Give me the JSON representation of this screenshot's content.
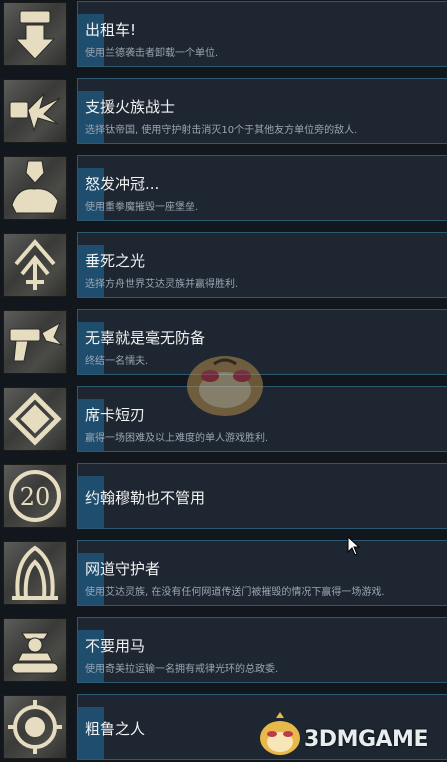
{
  "achievements": [
    {
      "title": "出租车!",
      "desc": "使用兰德袭击者卸载一个单位.",
      "icon": "taxi-arrow-icon"
    },
    {
      "title": "支援火族战士",
      "desc": "选择钛帝国, 使用守护射击消灭10个于其他友方单位旁的敌人.",
      "icon": "fire-support-icon"
    },
    {
      "title": "怒发冲冠...",
      "desc": "使用重拳魔摧毁一座堡垒.",
      "icon": "fist-icon"
    },
    {
      "title": "垂死之光",
      "desc": "选择方舟世界艾达灵族并赢得胜利.",
      "icon": "eldar-rune-icon"
    },
    {
      "title": "无辜就是毫无防备",
      "desc": "终结一名懦夫.",
      "icon": "pistol-icon"
    },
    {
      "title": "席卡短刃",
      "desc": "赢得一场困难及以上难度的单人游戏胜利.",
      "icon": "diamond-blade-icon"
    },
    {
      "title": "约翰穆勒也不管用",
      "desc": "",
      "icon": "number-20-icon",
      "badge": "20"
    },
    {
      "title": "网道守护者",
      "desc": "使用艾达灵族, 在没有任何网道传送门被摧毁的情况下赢得一场游戏.",
      "icon": "webway-gate-icon"
    },
    {
      "title": "不要用马",
      "desc": "使用奇美拉运输一名拥有戒律光环的总政委.",
      "icon": "commissar-tank-icon"
    },
    {
      "title": "粗鲁之人",
      "desc": "",
      "icon": "ork-gear-icon"
    }
  ],
  "watermark": {
    "text": "3DMGAME"
  }
}
